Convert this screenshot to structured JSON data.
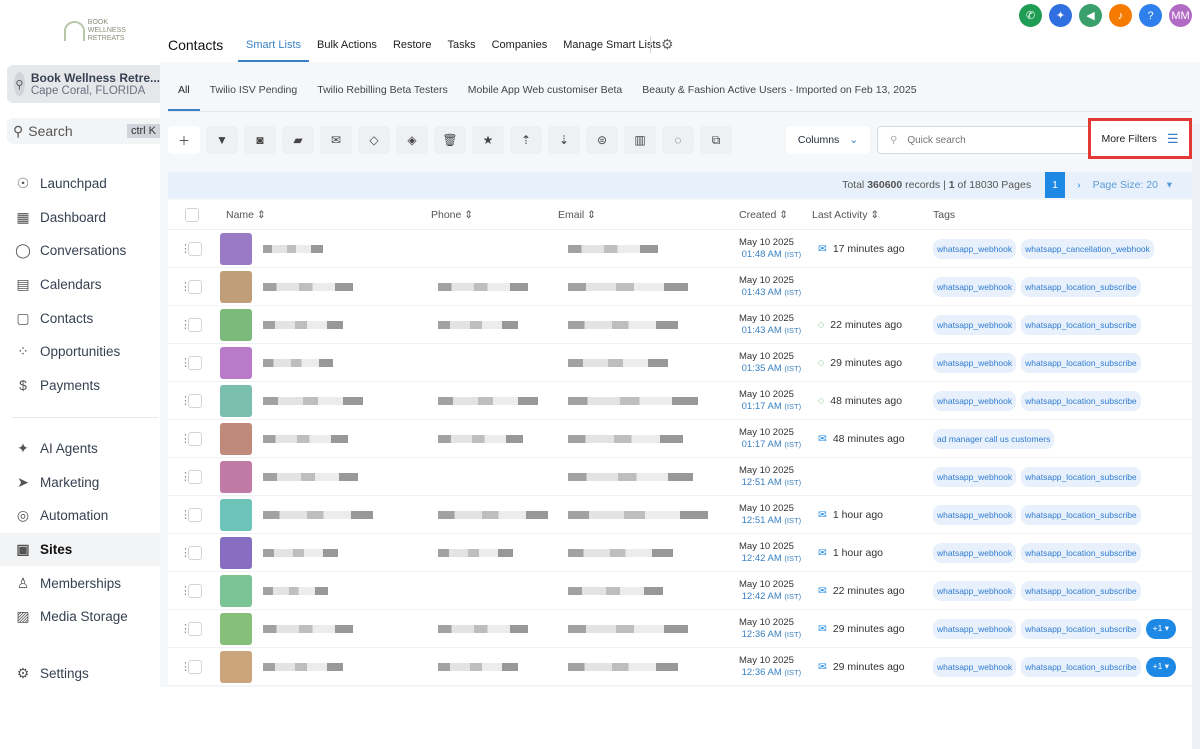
{
  "sidebar": {
    "logo_text": "BOOK WELLNESS RETREATS",
    "account": {
      "name": "Book Wellness Retre...",
      "location": "Cape Coral, FLORIDA"
    },
    "search": {
      "label": "Search",
      "shortcut": "ctrl K"
    },
    "items": [
      {
        "label": "Launchpad",
        "icon": "rocket-icon",
        "glyph": "☉"
      },
      {
        "label": "Dashboard",
        "icon": "dashboard-icon",
        "glyph": "▦"
      },
      {
        "label": "Conversations",
        "icon": "chat-icon",
        "glyph": "◯"
      },
      {
        "label": "Calendars",
        "icon": "calendar-icon",
        "glyph": "▤"
      },
      {
        "label": "Contacts",
        "icon": "contacts-icon",
        "glyph": "▢"
      },
      {
        "label": "Opportunities",
        "icon": "opportunities-icon",
        "glyph": "⁘"
      },
      {
        "label": "Payments",
        "icon": "payments-icon",
        "glyph": "$"
      }
    ],
    "items2": [
      {
        "label": "AI Agents",
        "icon": "ai-icon",
        "glyph": "✦"
      },
      {
        "label": "Marketing",
        "icon": "send-icon",
        "glyph": "➤"
      },
      {
        "label": "Automation",
        "icon": "automation-icon",
        "glyph": "◎"
      },
      {
        "label": "Sites",
        "icon": "globe-icon",
        "glyph": "▣"
      },
      {
        "label": "Memberships",
        "icon": "membership-icon",
        "glyph": "♙"
      },
      {
        "label": "Media Storage",
        "icon": "image-icon",
        "glyph": "▨"
      }
    ],
    "settings": "Settings"
  },
  "header": {
    "title": "Contacts",
    "tabs": [
      "Smart Lists",
      "Bulk Actions",
      "Restore",
      "Tasks",
      "Companies",
      "Manage Smart Lists"
    ],
    "avatar": "MM"
  },
  "smart_lists": [
    "All",
    "Twilio ISV Pending",
    "Twilio Rebilling Beta Testers",
    "Mobile App Web customiser Beta",
    "Beauty & Fashion Active Users - Imported on Feb 13, 2025"
  ],
  "toolbar": {
    "columns": "Columns",
    "search_placeholder": "Quick search",
    "more_filters": "More Filters"
  },
  "pagination": {
    "prefix": "Total",
    "total": "360600",
    "mid": "records |",
    "page": "1",
    "suffix": "of 18030 Pages",
    "current": "1",
    "page_size": "Page Size: 20"
  },
  "table": {
    "headers": [
      "Name",
      "Phone",
      "Email",
      "Created",
      "Last Activity",
      "Tags"
    ],
    "rows": [
      {
        "color": "#8e6bbf",
        "date": "May 10 2025",
        "time": "01:48 AM",
        "tz": "(IST)",
        "act": "email",
        "activity": "17 minutes ago",
        "tags": [
          "whatsapp_webhook",
          "whatsapp_cancellation_webhook"
        ],
        "more": ""
      },
      {
        "color": "#b8946a",
        "date": "May 10 2025",
        "time": "01:43 AM",
        "tz": "(IST)",
        "act": "",
        "activity": "",
        "tags": [
          "whatsapp_webhook",
          "whatsapp_location_subscribe"
        ],
        "more": ""
      },
      {
        "color": "#6db36d",
        "date": "May 10 2025",
        "time": "01:43 AM",
        "tz": "(IST)",
        "act": "whatsapp",
        "activity": "22 minutes ago",
        "tags": [
          "whatsapp_webhook",
          "whatsapp_location_subscribe"
        ],
        "more": ""
      },
      {
        "color": "#b26bc4",
        "date": "May 10 2025",
        "time": "01:35 AM",
        "tz": "(IST)",
        "act": "whatsapp",
        "activity": "29 minutes ago",
        "tags": [
          "whatsapp_webhook",
          "whatsapp_location_subscribe"
        ],
        "more": ""
      },
      {
        "color": "#6bb8a6",
        "date": "May 10 2025",
        "time": "01:17 AM",
        "tz": "(IST)",
        "act": "whatsapp",
        "activity": "48 minutes ago",
        "tags": [
          "whatsapp_webhook",
          "whatsapp_location_subscribe"
        ],
        "more": ""
      },
      {
        "color": "#b87d6a",
        "date": "May 10 2025",
        "time": "01:17 AM",
        "tz": "(IST)",
        "act": "email",
        "activity": "48 minutes ago",
        "tags": [
          "ad manager call us customers"
        ],
        "more": ""
      },
      {
        "color": "#b86b9b",
        "date": "May 10 2025",
        "time": "12:51 AM",
        "tz": "(IST)",
        "act": "",
        "activity": "",
        "tags": [
          "whatsapp_webhook",
          "whatsapp_location_subscribe"
        ],
        "more": ""
      },
      {
        "color": "#5ebdb0",
        "date": "May 10 2025",
        "time": "12:51 AM",
        "tz": "(IST)",
        "act": "email",
        "activity": "1 hour ago",
        "tags": [
          "whatsapp_webhook",
          "whatsapp_location_subscribe"
        ],
        "more": ""
      },
      {
        "color": "#7a5ebd",
        "date": "May 10 2025",
        "time": "12:42 AM",
        "tz": "(IST)",
        "act": "email",
        "activity": "1 hour ago",
        "tags": [
          "whatsapp_webhook",
          "whatsapp_location_subscribe"
        ],
        "more": ""
      },
      {
        "color": "#6bbd8a",
        "date": "May 10 2025",
        "time": "12:42 AM",
        "tz": "(IST)",
        "act": "email",
        "activity": "22 minutes ago",
        "tags": [
          "whatsapp_webhook",
          "whatsapp_location_subscribe"
        ],
        "more": ""
      },
      {
        "color": "#7ab86b",
        "date": "May 10 2025",
        "time": "12:36 AM",
        "tz": "(IST)",
        "act": "email",
        "activity": "29 minutes ago",
        "tags": [
          "whatsapp_webhook",
          "whatsapp_location_subscribe"
        ],
        "more": "+1 ▾"
      },
      {
        "color": "#c49a6b",
        "date": "May 10 2025",
        "time": "12:36 AM",
        "tz": "(IST)",
        "act": "email",
        "activity": "29 minutes ago",
        "tags": [
          "whatsapp_webhook",
          "whatsapp_location_subscribe"
        ],
        "more": "+1 ▾"
      }
    ]
  }
}
